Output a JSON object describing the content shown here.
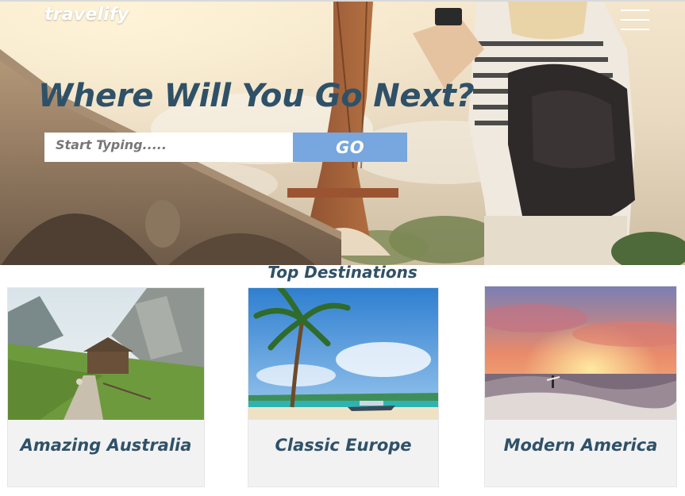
{
  "brand": {
    "logo_text": "travelify"
  },
  "hero": {
    "headline": "Where Will You Go Next?",
    "search": {
      "placeholder": "Start Typing.....",
      "value": ""
    },
    "go_label": "GO"
  },
  "destinations": {
    "title": "Top Destinations",
    "cards": [
      {
        "label": "Amazing Australia"
      },
      {
        "label": "Classic Europe"
      },
      {
        "label": "Modern America"
      }
    ]
  },
  "colors": {
    "accent_blue": "#78a6de",
    "heading_navy": "#2f5168",
    "card_bg": "#f2f2f2"
  },
  "icons": {
    "menu": "hamburger-menu-icon"
  }
}
